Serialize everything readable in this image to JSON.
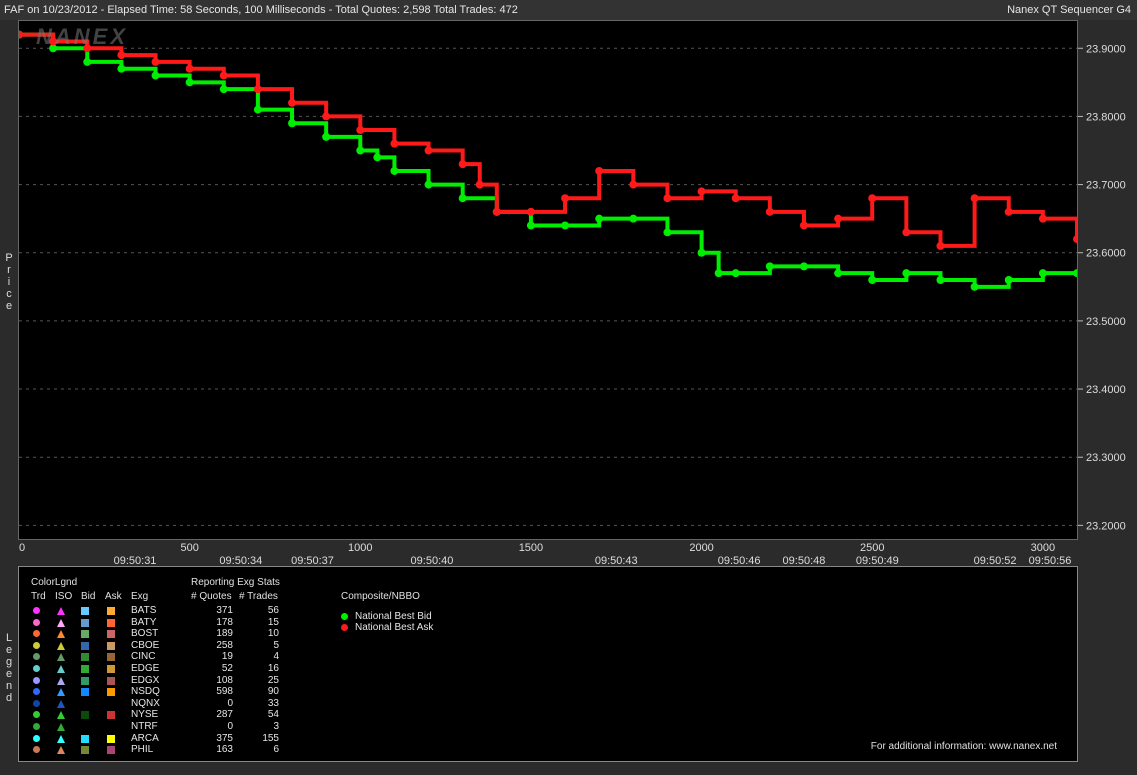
{
  "window": {
    "title_left": "FAF on 10/23/2012  -  Elapsed Time: 58 Seconds, 100 Milliseconds  -  Total Quotes: 2,598  Total Trades: 472",
    "title_right": "Nanex QT Sequencer G4",
    "logo": "NANEX"
  },
  "side_labels": {
    "price": [
      "P",
      "r",
      "i",
      "c",
      "e"
    ],
    "legend": [
      "L",
      "e",
      "g",
      "e",
      "n",
      "d"
    ]
  },
  "chart_data": {
    "type": "scatter",
    "ylabel": "Price",
    "ylim": [
      23.18,
      23.94
    ],
    "xlim": [
      0,
      3100
    ],
    "y_ticks": [
      "23.9000",
      "23.8000",
      "23.7000",
      "23.6000",
      "23.5000",
      "23.4000",
      "23.3000",
      "23.2000"
    ],
    "y_tick_values": [
      23.9,
      23.8,
      23.7,
      23.6,
      23.5,
      23.4,
      23.3,
      23.2
    ],
    "x_ticks": [
      0,
      500,
      1000,
      1500,
      2000,
      2500,
      3000
    ],
    "time_labels": [
      {
        "x": 340,
        "label": "09:50:31"
      },
      {
        "x": 650,
        "label": "09:50:34"
      },
      {
        "x": 860,
        "label": "09:50:37"
      },
      {
        "x": 1210,
        "label": "09:50:40"
      },
      {
        "x": 1750,
        "label": "09:50:43"
      },
      {
        "x": 2110,
        "label": "09:50:46"
      },
      {
        "x": 2300,
        "label": "09:50:48"
      },
      {
        "x": 2515,
        "label": "09:50:49"
      },
      {
        "x": 2860,
        "label": "09:50:52"
      },
      {
        "x": 3060,
        "label": "09:50:56"
      }
    ],
    "grid": true,
    "series": [
      {
        "name": "National Best Bid",
        "color": "#00ee00",
        "x": [
          0,
          100,
          200,
          300,
          400,
          500,
          600,
          700,
          800,
          900,
          1000,
          1050,
          1100,
          1200,
          1300,
          1400,
          1500,
          1600,
          1700,
          1800,
          1900,
          2000,
          2050,
          2100,
          2200,
          2300,
          2400,
          2500,
          2600,
          2700,
          2800,
          2900,
          3000,
          3100
        ],
        "y": [
          23.92,
          23.9,
          23.88,
          23.87,
          23.86,
          23.85,
          23.84,
          23.81,
          23.79,
          23.77,
          23.75,
          23.74,
          23.72,
          23.7,
          23.68,
          23.66,
          23.64,
          23.64,
          23.65,
          23.65,
          23.63,
          23.6,
          23.57,
          23.57,
          23.58,
          23.58,
          23.57,
          23.56,
          23.57,
          23.56,
          23.55,
          23.56,
          23.57,
          23.57
        ]
      },
      {
        "name": "National Best Ask",
        "color": "#ff1a1a",
        "x": [
          0,
          100,
          200,
          300,
          400,
          500,
          600,
          700,
          800,
          900,
          1000,
          1100,
          1200,
          1300,
          1350,
          1400,
          1500,
          1600,
          1700,
          1800,
          1900,
          2000,
          2100,
          2200,
          2300,
          2400,
          2500,
          2600,
          2700,
          2800,
          2900,
          3000,
          3100
        ],
        "y": [
          23.92,
          23.91,
          23.9,
          23.89,
          23.88,
          23.87,
          23.86,
          23.84,
          23.82,
          23.8,
          23.78,
          23.76,
          23.75,
          23.73,
          23.7,
          23.66,
          23.66,
          23.68,
          23.72,
          23.7,
          23.68,
          23.69,
          23.68,
          23.66,
          23.64,
          23.65,
          23.68,
          23.63,
          23.61,
          23.68,
          23.66,
          23.65,
          23.62
        ]
      }
    ]
  },
  "legend": {
    "colorlgnd_title": "ColorLgnd",
    "stats_title": "Reporting Exg Stats",
    "composite_title": "Composite/NBBO",
    "col_headers": {
      "trd": "Trd",
      "iso": "ISO",
      "bid": "Bid",
      "ask": "Ask",
      "exg": "Exg",
      "quotes": "# Quotes",
      "trades": "# Trades"
    },
    "exchanges": [
      {
        "exg": "BATS",
        "quotes": "371",
        "trades": "56",
        "trd": "#ff33ff",
        "iso": "#ff33ff",
        "bid": "#66ccff",
        "ask": "#ffaa33"
      },
      {
        "exg": "BATY",
        "quotes": "178",
        "trades": "15",
        "trd": "#ff66cc",
        "iso": "#ffaaff",
        "bid": "#6699cc",
        "ask": "#ff6633"
      },
      {
        "exg": "BOST",
        "quotes": "189",
        "trades": "10",
        "trd": "#ff6633",
        "iso": "#ff8833",
        "bid": "#66aa66",
        "ask": "#cc6666"
      },
      {
        "exg": "CBOE",
        "quotes": "258",
        "trades": "5",
        "trd": "#cccc33",
        "iso": "#cccc33",
        "bid": "#3366aa",
        "ask": "#cc9966"
      },
      {
        "exg": "CINC",
        "quotes": "19",
        "trades": "4",
        "trd": "#669966",
        "iso": "#669966",
        "bid": "#338833",
        "ask": "#996633"
      },
      {
        "exg": "EDGE",
        "quotes": "52",
        "trades": "16",
        "trd": "#66cccc",
        "iso": "#66cccc",
        "bid": "#33aa33",
        "ask": "#cc9933"
      },
      {
        "exg": "EDGX",
        "quotes": "108",
        "trades": "25",
        "trd": "#9999ff",
        "iso": "#aaaaee",
        "bid": "#339966",
        "ask": "#aa5555"
      },
      {
        "exg": "NSDQ",
        "quotes": "598",
        "trades": "90",
        "trd": "#3366ff",
        "iso": "#3399ff",
        "bid": "#1188ff",
        "ask": "#ff9900"
      },
      {
        "exg": "NQNX",
        "quotes": "0",
        "trades": "33",
        "trd": "#1144aa",
        "iso": "#2255bb",
        "bid": "",
        "ask": ""
      },
      {
        "exg": "NYSE",
        "quotes": "287",
        "trades": "54",
        "trd": "#33cc33",
        "iso": "#33cc33",
        "bid": "#0a4a0a",
        "ask": "#cc3333"
      },
      {
        "exg": "NTRF",
        "quotes": "0",
        "trades": "3",
        "trd": "#33aa33",
        "iso": "#33aa33",
        "bid": "",
        "ask": ""
      },
      {
        "exg": "ARCA",
        "quotes": "375",
        "trades": "155",
        "trd": "#33ffff",
        "iso": "#33ffff",
        "bid": "#22ddff",
        "ask": "#ffff00"
      },
      {
        "exg": "PHIL",
        "quotes": "163",
        "trades": "6",
        "trd": "#cc7755",
        "iso": "#dd8855",
        "bid": "#778833",
        "ask": "#aa4477"
      }
    ],
    "nbbo": [
      {
        "label": "National Best Bid",
        "color": "#00ee00"
      },
      {
        "label": "National Best Ask",
        "color": "#ff1a1a"
      }
    ],
    "footer": "For additional information: www.nanex.net"
  }
}
